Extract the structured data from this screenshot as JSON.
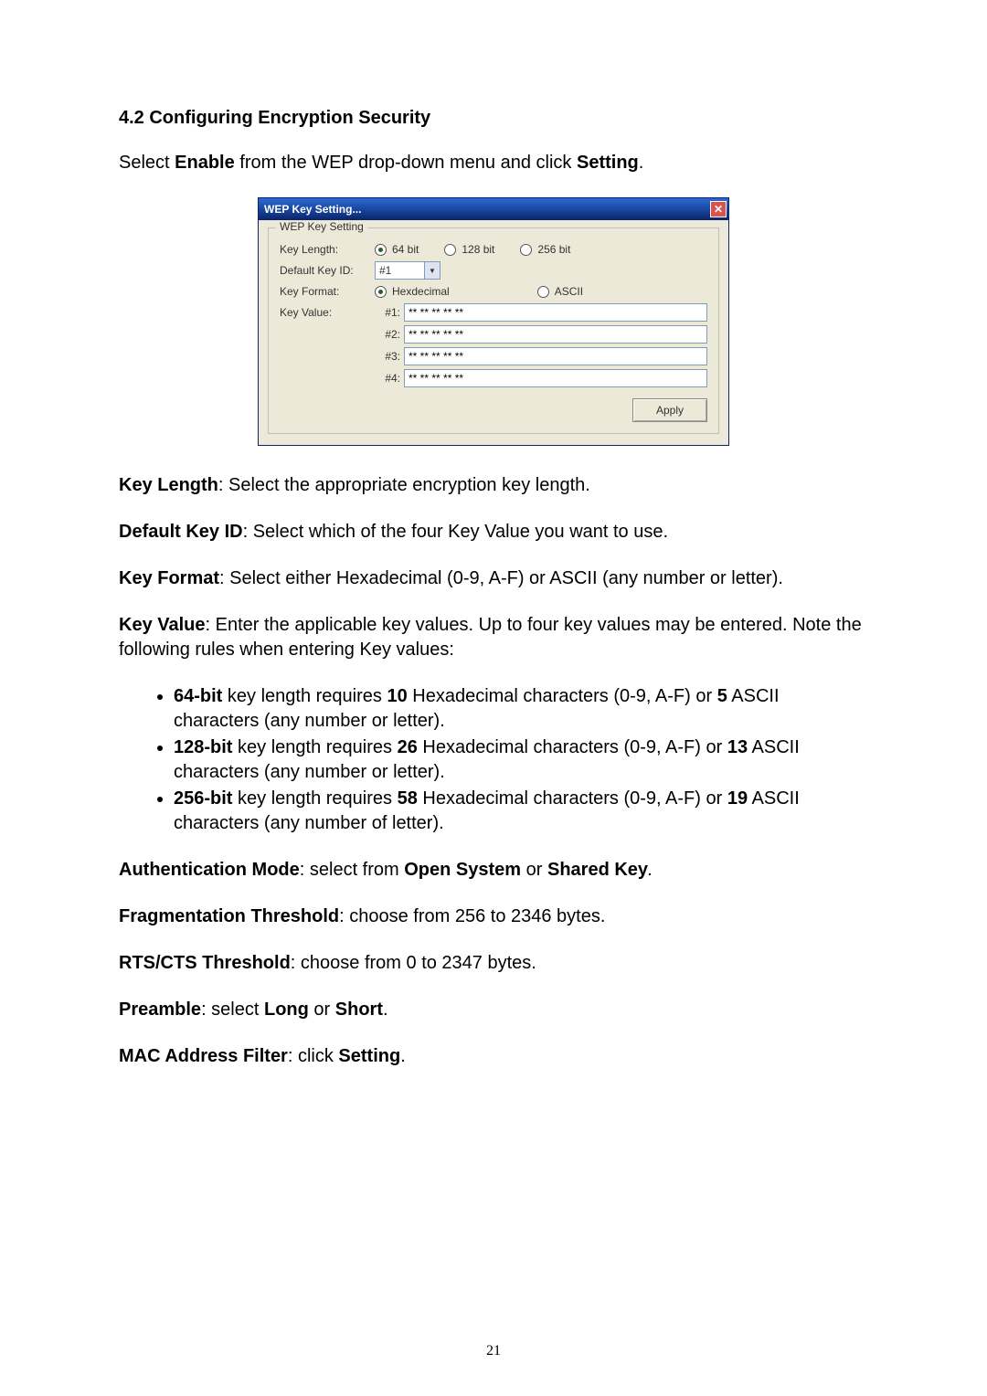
{
  "heading": "4.2 Configuring Encryption Security",
  "intro": {
    "pre": "Select ",
    "b1": "Enable",
    "mid": " from the WEP drop-down menu and click ",
    "b2": "Setting",
    "post": "."
  },
  "dialog": {
    "title": "WEP Key Setting...",
    "close_x": "✕",
    "legend": "WEP Key Setting",
    "key_length_label": "Key Length:",
    "len_opts": {
      "opt64": "64 bit",
      "opt128": "128 bit",
      "opt256": "256 bit"
    },
    "default_key_label": "Default Key ID:",
    "default_key_value": "#1",
    "key_format_label": "Key Format:",
    "fmt_opts": {
      "hex": "Hexdecimal",
      "ascii": "ASCII"
    },
    "key_value_label": "Key Value:",
    "idx": {
      "i1": "#1:",
      "i2": "#2:",
      "i3": "#3:",
      "i4": "#4:"
    },
    "masked": "** ** ** ** **",
    "apply": "Apply"
  },
  "desc": {
    "kl_b": "Key Length",
    "kl_t": ": Select the appropriate encryption key length.",
    "dk_b": "Default Key ID",
    "dk_t": ": Select which of the four Key Value you want to use.",
    "kf_b": "Key Format",
    "kf_t": ": Select either Hexadecimal (0-9, A-F) or ASCII (any number or letter).",
    "kv_b": "Key Value",
    "kv_t": ": Enter the applicable key values. Up to four key values may be entered. Note the following rules when entering Key values:"
  },
  "bullets": {
    "b1": {
      "s1": "64-bit",
      "s2": " key length requires ",
      "s3": "10",
      "s4": " Hexadecimal characters (0-9, A-F) or ",
      "s5": "5",
      "s6": " ASCII characters (any number or letter)."
    },
    "b2": {
      "s1": "128-bit",
      "s2": " key length requires ",
      "s3": "26",
      "s4": " Hexadecimal characters (0-9, A-F) or ",
      "s5": "13",
      "s6": " ASCII characters (any number or letter)."
    },
    "b3": {
      "s1": "256-bit",
      "s2": " key length requires ",
      "s3": "58",
      "s4": " Hexadecimal characters (0-9, A-F) or ",
      "s5": "19",
      "s6": " ASCII characters (any number of letter)."
    }
  },
  "tail": {
    "auth_b": "Authentication Mode",
    "auth_t1": ": select from ",
    "auth_b2": "Open System",
    "auth_t2": " or ",
    "auth_b3": "Shared Key",
    "auth_post": ".",
    "frag_b": "Fragmentation Threshold",
    "frag_t": ": choose from 256 to 2346 bytes.",
    "rts_b": "RTS/CTS Threshold",
    "rts_t": ": choose from 0 to 2347 bytes.",
    "pre_b": "Preamble",
    "pre_t1": ": select ",
    "pre_b2": "Long",
    "pre_t2": " or ",
    "pre_b3": "Short",
    "pre_post": ".",
    "mac_b": "MAC Address Filter",
    "mac_t1": ": click ",
    "mac_b2": "Setting",
    "mac_post": "."
  },
  "pagenum": "21"
}
